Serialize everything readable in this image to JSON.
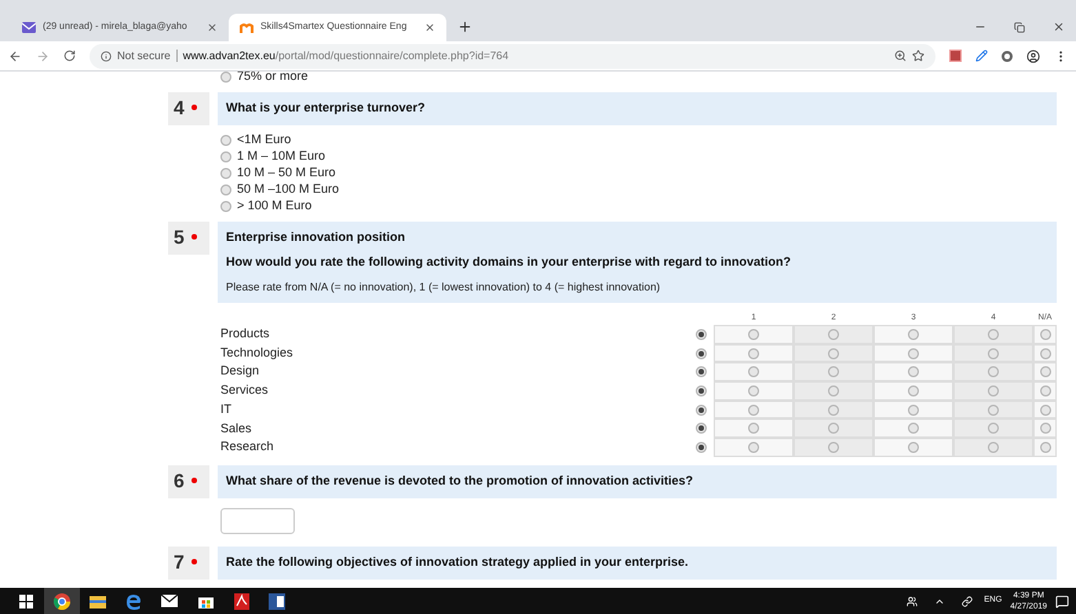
{
  "browser": {
    "tabs": [
      {
        "title": "(29 unread) - mirela_blaga@yaho",
        "selected": false,
        "kind": "mail"
      },
      {
        "title": "Skills4Smartex Questionnaire Eng",
        "selected": true,
        "kind": "moodle"
      }
    ],
    "address": {
      "security": "Not secure",
      "domain": "www.advan2tex.eu",
      "path": "/portal/mod/questionnaire/complete.php?id=764"
    }
  },
  "page": {
    "previous_option": {
      "label": "75% or more",
      "selected": false
    },
    "questions": [
      {
        "number": "4",
        "required": true,
        "kind": "radio",
        "title": "What is your enterprise turnover?",
        "options": [
          {
            "label": "<1M Euro",
            "selected": false
          },
          {
            "label": "1 M – 10M Euro",
            "selected": false
          },
          {
            "label": "10 M – 50 M Euro",
            "selected": false
          },
          {
            "label": "50 M –100 M Euro",
            "selected": false
          },
          {
            "label": "> 100 M Euro",
            "selected": false
          }
        ]
      },
      {
        "number": "5",
        "required": true,
        "kind": "matrix",
        "title": "Enterprise innovation position",
        "prompt": "How would you rate the following activity domains in your enterprise with regard to innovation?",
        "instruction": "Please rate from N/A (= no innovation), 1 (= lowest innovation) to 4 (= highest innovation)",
        "columns": [
          "1",
          "2",
          "3",
          "4",
          "N/A"
        ],
        "rows": [
          {
            "label": "Products",
            "choices": [
              true,
              false,
              false,
              false,
              false,
              false
            ]
          },
          {
            "label": "Technologies",
            "choices": [
              true,
              false,
              false,
              false,
              false,
              false
            ]
          },
          {
            "label": "Design",
            "choices": [
              true,
              false,
              false,
              false,
              false,
              false
            ]
          },
          {
            "label": "Services",
            "choices": [
              true,
              false,
              false,
              false,
              false,
              false
            ]
          },
          {
            "label": "IT",
            "choices": [
              true,
              false,
              false,
              false,
              false,
              false
            ]
          },
          {
            "label": "Sales",
            "choices": [
              true,
              false,
              false,
              false,
              false,
              false
            ]
          },
          {
            "label": "Research",
            "choices": [
              true,
              false,
              false,
              false,
              false,
              false
            ]
          }
        ]
      },
      {
        "number": "6",
        "required": true,
        "kind": "text",
        "title": "What share of the revenue is devoted to the promotion of innovation activities?"
      },
      {
        "number": "7",
        "required": true,
        "kind": "rating",
        "title": "Rate the following objectives of innovation strategy applied in your enterprise."
      }
    ]
  },
  "taskbar": {
    "language": "ENG",
    "time": "4:39 PM",
    "date": "4/27/2019"
  }
}
